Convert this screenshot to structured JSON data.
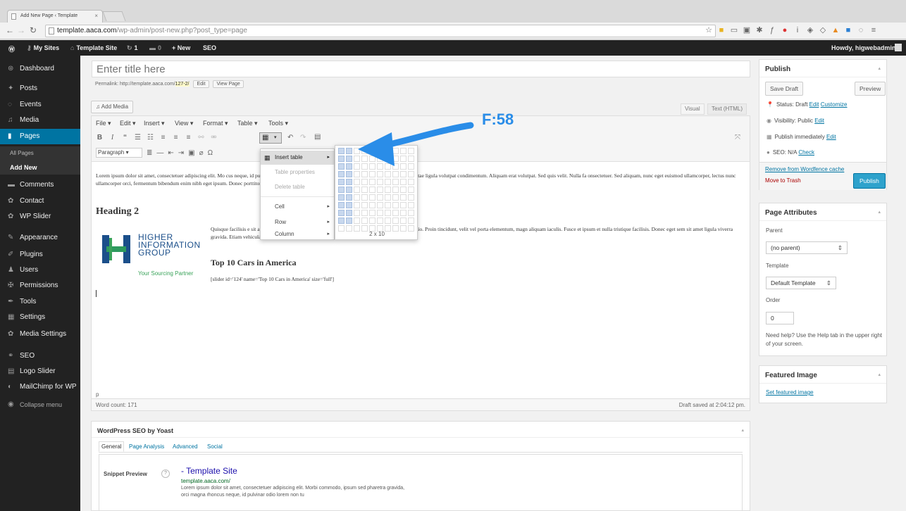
{
  "browser": {
    "tab_title": "Add New Page ‹ Template",
    "tab_close": "×",
    "url_host": "template.aaca.com",
    "url_path": "/wp-admin/post-new.php?post_type=page"
  },
  "adminbar": {
    "my_sites": "My Sites",
    "site_name": "Template Site",
    "updates": "1",
    "comments": "0",
    "new": "+ New",
    "seo": "SEO",
    "howdy": "Howdy, higwebadmin"
  },
  "sidebar": {
    "items": [
      {
        "label": "Dashboard",
        "icon": "dashboard-icon",
        "glyph": "⊛"
      },
      {
        "label": "Posts",
        "icon": "pin-icon",
        "glyph": "✦"
      },
      {
        "label": "Events",
        "icon": "events-icon",
        "glyph": "◌"
      },
      {
        "label": "Media",
        "icon": "media-icon",
        "glyph": "♫"
      },
      {
        "label": "Pages",
        "icon": "pages-icon",
        "glyph": "▮"
      },
      {
        "label": "All Pages"
      },
      {
        "label": "Add New"
      },
      {
        "label": "Comments",
        "icon": "comments-icon",
        "glyph": "▬"
      },
      {
        "label": "Contact",
        "icon": "contact-icon",
        "glyph": "✿"
      },
      {
        "label": "WP Slider",
        "icon": "slider-icon",
        "glyph": "✿"
      },
      {
        "label": "Appearance",
        "icon": "appearance-icon",
        "glyph": "✎"
      },
      {
        "label": "Plugins",
        "icon": "plugins-icon",
        "glyph": "✐"
      },
      {
        "label": "Users",
        "icon": "users-icon",
        "glyph": "♟"
      },
      {
        "label": "Permissions",
        "icon": "permissions-icon",
        "glyph": "✠"
      },
      {
        "label": "Tools",
        "icon": "tools-icon",
        "glyph": "✒"
      },
      {
        "label": "Settings",
        "icon": "settings-icon",
        "glyph": "▦"
      },
      {
        "label": "Media Settings",
        "icon": "media-settings-icon",
        "glyph": "✿"
      },
      {
        "label": "SEO",
        "icon": "seo-icon",
        "glyph": "⚭"
      },
      {
        "label": "Logo Slider",
        "icon": "logo-slider-icon",
        "glyph": "▤"
      },
      {
        "label": "MailChimp for WP",
        "icon": "mailchimp-icon",
        "glyph": "◐"
      },
      {
        "label": "Collapse menu",
        "icon": "collapse-icon",
        "glyph": "◉"
      }
    ]
  },
  "editor": {
    "title_placeholder": "Enter title here",
    "permalink_label": "Permalink:",
    "permalink_base": "http://template.aaca.com/",
    "permalink_slug": "127-2/",
    "edit_btn": "Edit",
    "view_btn": "View Page",
    "add_media": "Add Media",
    "tab_visual": "Visual",
    "tab_text": "Text (HTML)",
    "menubar": [
      "File ▾",
      "Edit ▾",
      "Insert ▾",
      "View ▾",
      "Format ▾",
      "Table ▾",
      "Tools ▾"
    ],
    "format_select": "Paragraph",
    "para1": "Lorem ipsum dolor sit amet, consectetuer adipiscing elit. Mo                                                                                               cus neque, id pulvinar odio lorem non turpis. Nullam sit amet enim. Suspendisse id velit vitae ligula volutpat condimentum. Aliquam erat volutpat. Sed quis velit. Nulla fa                                                                                              onsectetuer. Sed aliquam, nunc eget euismod ullamcorper, lectus nunc ullamcorper orci, fermentum bibendum enim nibh eget ipsum. Donec porttitor ligula eu dolor. Maecenas v                                                                                                im, accumsan eu, blandit sed, blandit a, eros.",
    "heading2": "Heading 2",
    "logo_line1": "HIGHER",
    "logo_line2": "INFORMATION",
    "logo_line3": "GROUP",
    "logo_tagline": "Your Sourcing Partner",
    "para2": "Quisque facilisis e                                                                                        sit amet rhoncus ornare, erat elit consectetuer erat, id egestas pede nibh eget odio. Proin tincidunt, velit vel porta elementum, magn                                                                                     aliquam iaculis. Fusce et ipsum et nulla tristique facilisis. Donec eget sem sit amet ligula viverra gravida. Etiam vehicula urna vel turpis.",
    "heading3": "Top 10 Cars in America",
    "shortcode": "[slider id='124' name='Top 10 Cars in America' size='full']",
    "path": "p",
    "word_count": "Word count: 171",
    "draft_saved": "Draft saved at 2:04:12 pm."
  },
  "table_menu": {
    "insert_table": "Insert table",
    "table_properties": "Table properties",
    "delete_table": "Delete table",
    "cell": "Cell",
    "row": "Row",
    "column": "Column",
    "grid_size": "2 x 10",
    "selected_cols": 2,
    "selected_rows": 10
  },
  "callout": "F:58",
  "publish": {
    "title": "Publish",
    "save_draft": "Save Draft",
    "preview": "Preview",
    "status": "Status: Draft",
    "status_edit": "Edit",
    "customize": "Customize",
    "visibility": "Visibility: Public",
    "visibility_edit": "Edit",
    "publish_time": "Publish immediately",
    "publish_time_edit": "Edit",
    "seo": "SEO: N/A",
    "seo_check": "Check",
    "remove_cache": "Remove from Wordfence cache",
    "trash": "Move to Trash",
    "publish_btn": "Publish"
  },
  "page_attributes": {
    "title": "Page Attributes",
    "parent_label": "Parent",
    "parent_value": "(no parent)",
    "template_label": "Template",
    "template_value": "Default Template",
    "order_label": "Order",
    "order_value": "0",
    "help": "Need help? Use the Help tab in the upper right of your screen."
  },
  "featured": {
    "title": "Featured Image",
    "set_link": "Set featured image"
  },
  "yoast": {
    "title": "WordPress SEO by Yoast",
    "tabs": [
      "General",
      "Page Analysis",
      "Advanced",
      "Social"
    ],
    "snippet_label": "Snippet Preview",
    "snippet_title": "- Template Site",
    "snippet_url": "template.aaca.com/",
    "snippet_desc": "Lorem ipsum dolor sit amet, consectetuer adipiscing elit. Morbi commodo, ipsum sed pharetra gravida, orci magna rhoncus neque, id pulvinar odio lorem non tu"
  }
}
